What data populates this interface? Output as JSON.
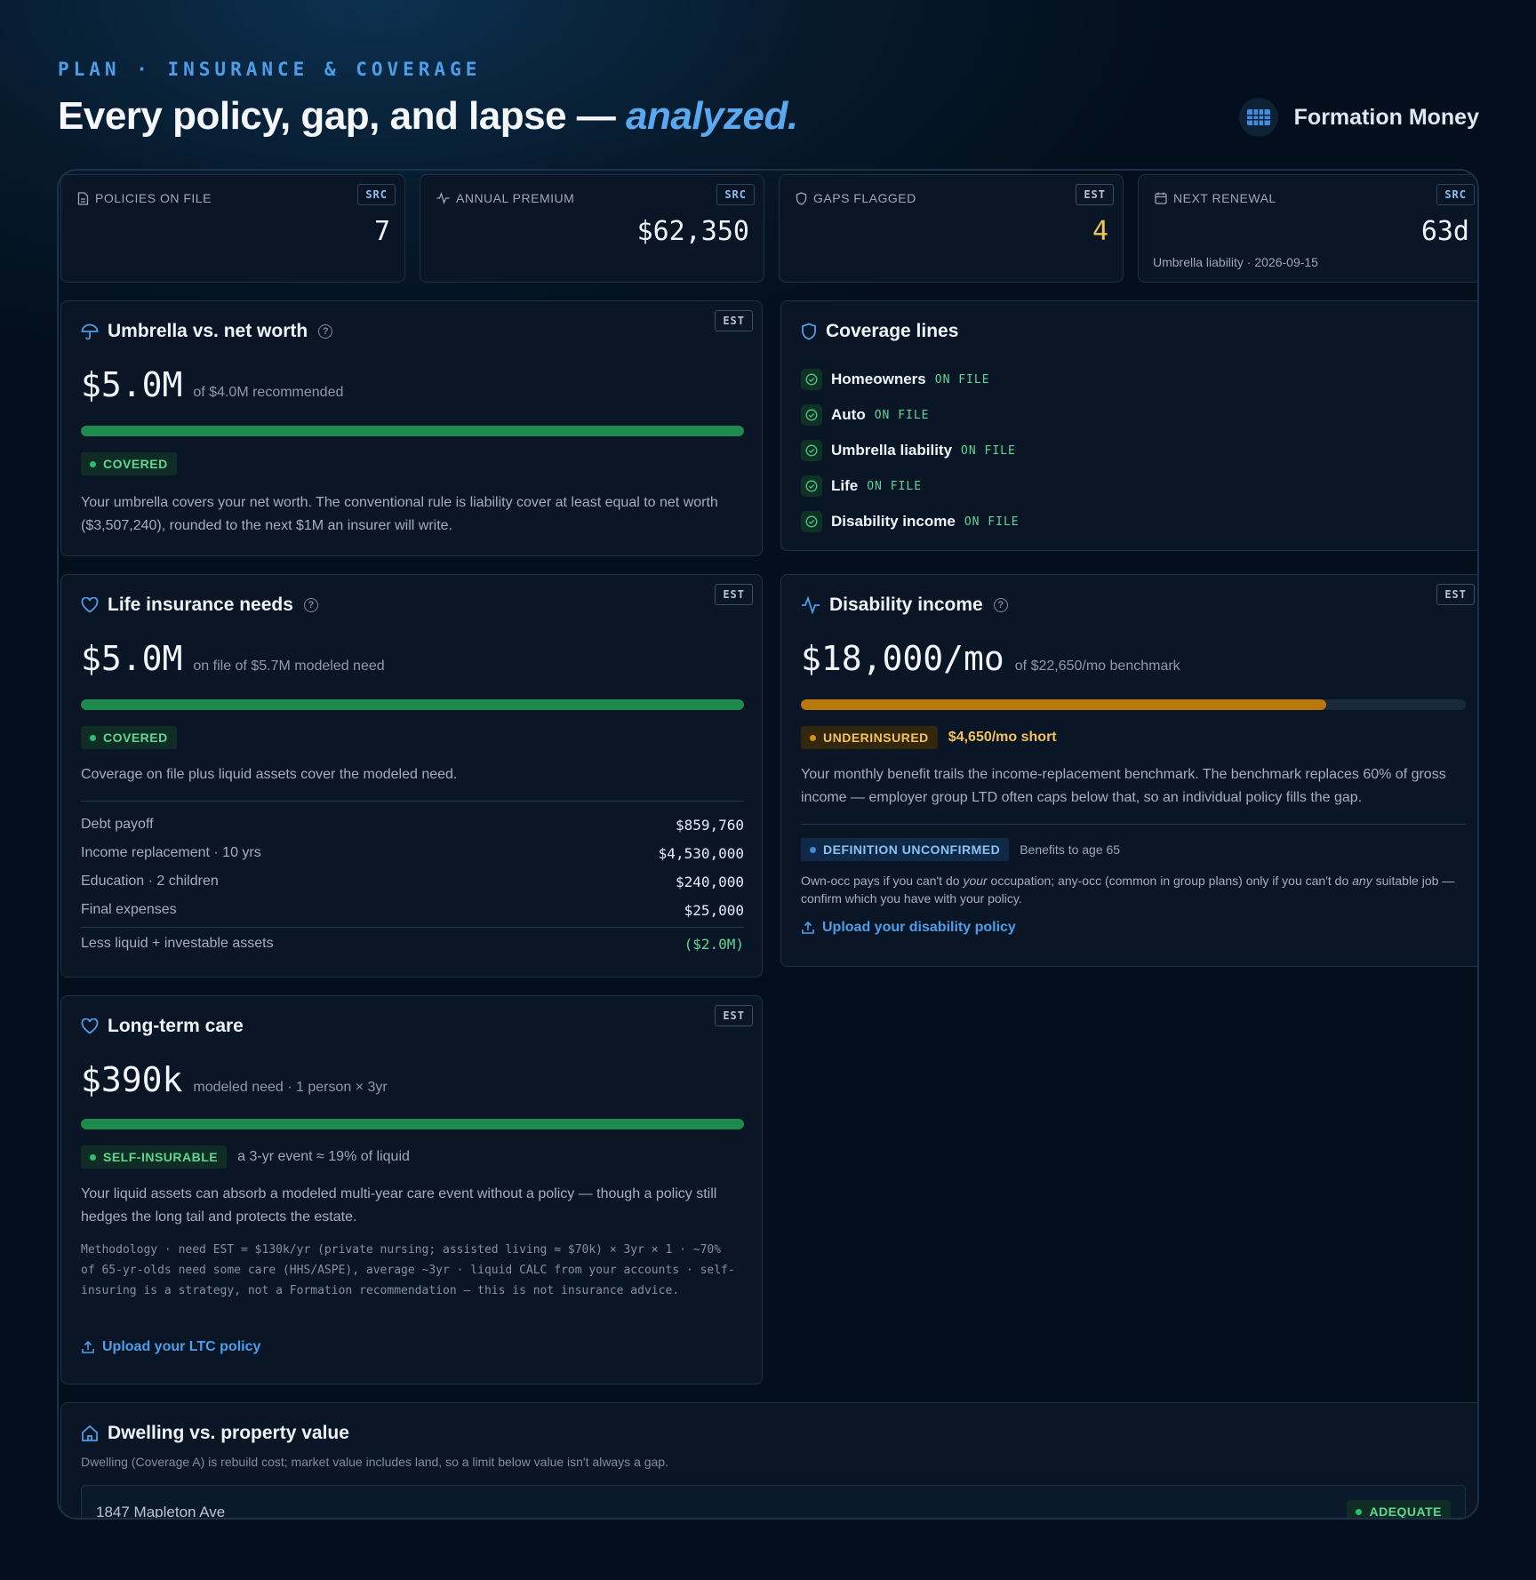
{
  "header": {
    "eyebrow": "PLAN · INSURANCE & COVERAGE",
    "headline": "Every policy, gap, and lapse — ",
    "headline_accent": "analyzed.",
    "brand": "Formation Money"
  },
  "kpis": [
    {
      "label": "POLICIES ON FILE",
      "tag": "SRC",
      "value": "7",
      "icon": "document-icon"
    },
    {
      "label": "ANNUAL PREMIUM",
      "tag": "SRC",
      "value": "$62,350",
      "icon": "pulse-icon"
    },
    {
      "label": "GAPS FLAGGED",
      "tag": "EST",
      "value": "4",
      "icon": "shield-icon",
      "value_color": "#f2c35a"
    },
    {
      "label": "NEXT RENEWAL",
      "tag": "SRC",
      "value": "63d",
      "sub": "Umbrella liability · 2026-09-15",
      "icon": "calendar-icon"
    }
  ],
  "umbrella": {
    "title": "Umbrella vs. net worth",
    "tag": "EST",
    "value": "$5.0M",
    "value_sub": "of $4.0M recommended",
    "fill": 1.0,
    "status": "COVERED",
    "description": "Your umbrella covers your net worth. The conventional rule is liability cover at least equal to net worth ($3,507,240), rounded to the next $1M an insurer will write."
  },
  "coverage": {
    "title": "Coverage lines",
    "items": [
      {
        "name": "Homeowners",
        "status": "ON FILE"
      },
      {
        "name": "Auto",
        "status": "ON FILE"
      },
      {
        "name": "Umbrella liability",
        "status": "ON FILE"
      },
      {
        "name": "Life",
        "status": "ON FILE"
      },
      {
        "name": "Disability income",
        "status": "ON FILE"
      }
    ]
  },
  "life": {
    "title": "Life insurance needs",
    "tag": "EST",
    "value": "$5.0M",
    "value_sub": "on file of $5.7M modeled need",
    "fill": 1.0,
    "status": "COVERED",
    "description": "Coverage on file plus liquid assets cover the modeled need.",
    "rows": [
      {
        "label": "Debt payoff",
        "value": "$859,760"
      },
      {
        "label": "Income replacement · 10 yrs",
        "value": "$4,530,000"
      },
      {
        "label": "Education · 2 children",
        "value": "$240,000"
      },
      {
        "label": "Final expenses",
        "value": "$25,000"
      }
    ],
    "less_label": "Less liquid + investable assets",
    "less_value": "($2.0M)"
  },
  "disability": {
    "title": "Disability income",
    "tag": "EST",
    "value": "$18,000/mo",
    "value_sub": "of $22,650/mo benchmark",
    "fill": 0.79,
    "status": "UNDERINSURED",
    "shortfall": "$4,650/mo short",
    "description": "Your monthly benefit trails the income-replacement benchmark. The benchmark replaces 60% of gross income — employer group LTD often caps below that, so an individual policy fills the gap.",
    "def_status": "DEFINITION UNCONFIRMED",
    "def_note": "Benefits to age 65",
    "def_text_1": "Own-occ pays if you can't do ",
    "def_text_em1": "your",
    "def_text_2": " occupation; any-occ (common in group plans) only if you can't do ",
    "def_text_em2": "any",
    "def_text_3": " suitable job — confirm which you have with your policy.",
    "upload": "Upload your disability policy"
  },
  "ltc": {
    "title": "Long-term care",
    "tag": "EST",
    "value": "$390k",
    "value_sub": "modeled need · 1 person × 3yr",
    "fill": 1.0,
    "status": "SELF-INSURABLE",
    "status_note": "a 3-yr event ≈ 19% of liquid",
    "description": "Your liquid assets can absorb a modeled multi-year care event without a policy — though a policy still hedges the long tail and protects the estate.",
    "methodology": "Methodology · need EST = $130k/yr (private nursing; assisted living ≈ $70k) × 3yr × 1 · ~70% of 65-yr-olds need some care (HHS/ASPE), average ~3yr · liquid CALC from your accounts · self-insuring is a strategy, not a Formation recommendation — this is not insurance advice.",
    "upload": "Upload your LTC policy"
  },
  "dwelling": {
    "title": "Dwelling vs. property value",
    "subtitle": "Dwelling (Coverage A) is rebuild cost; market value includes land, so a limit below value isn't always a gap.",
    "property": "1847 Mapleton Ave",
    "status": "ADEQUATE"
  },
  "colors": {
    "accent": "#4f9de8",
    "green": "#1e8a4d",
    "amber": "#b8780c"
  }
}
